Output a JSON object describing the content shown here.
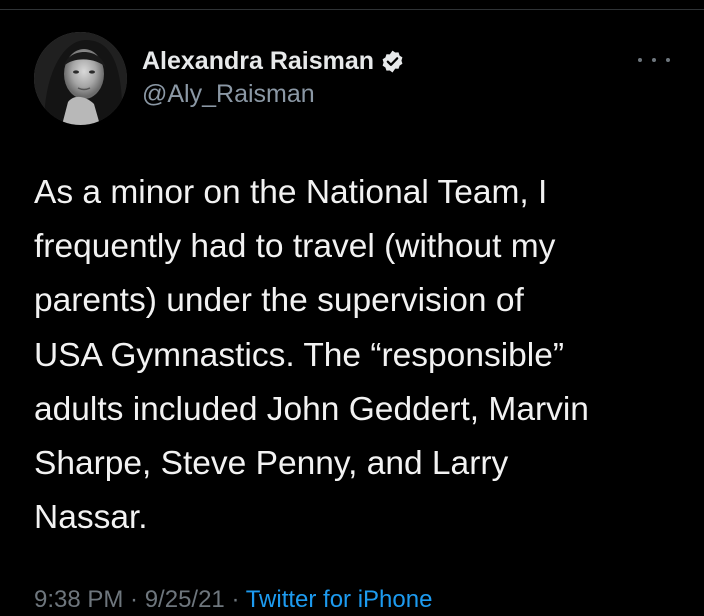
{
  "author": {
    "display_name": "Alexandra Raisman",
    "handle": "@Aly_Raisman",
    "verified": true,
    "avatar_icon": "profile-photo-avatar"
  },
  "more_icon": "ellipsis-icon",
  "tweet": {
    "lines": [
      "As a minor on the National Team, I",
      "frequently had to travel (without my",
      "parents) under the supervision of",
      "USA Gymnastics. The “responsible”",
      "adults included John Geddert, Marvin",
      "Sharpe, Steve Penny, and Larry",
      "Nassar."
    ]
  },
  "meta": {
    "timestamp": "9:38 PM · 9/25/21 · ",
    "source": "Twitter for iPhone"
  },
  "colors": {
    "background": "#000000",
    "text_primary": "#e7e9ea",
    "text_secondary": "#8b98a5",
    "link": "#1d9bf0",
    "divider": "#2f3336"
  }
}
